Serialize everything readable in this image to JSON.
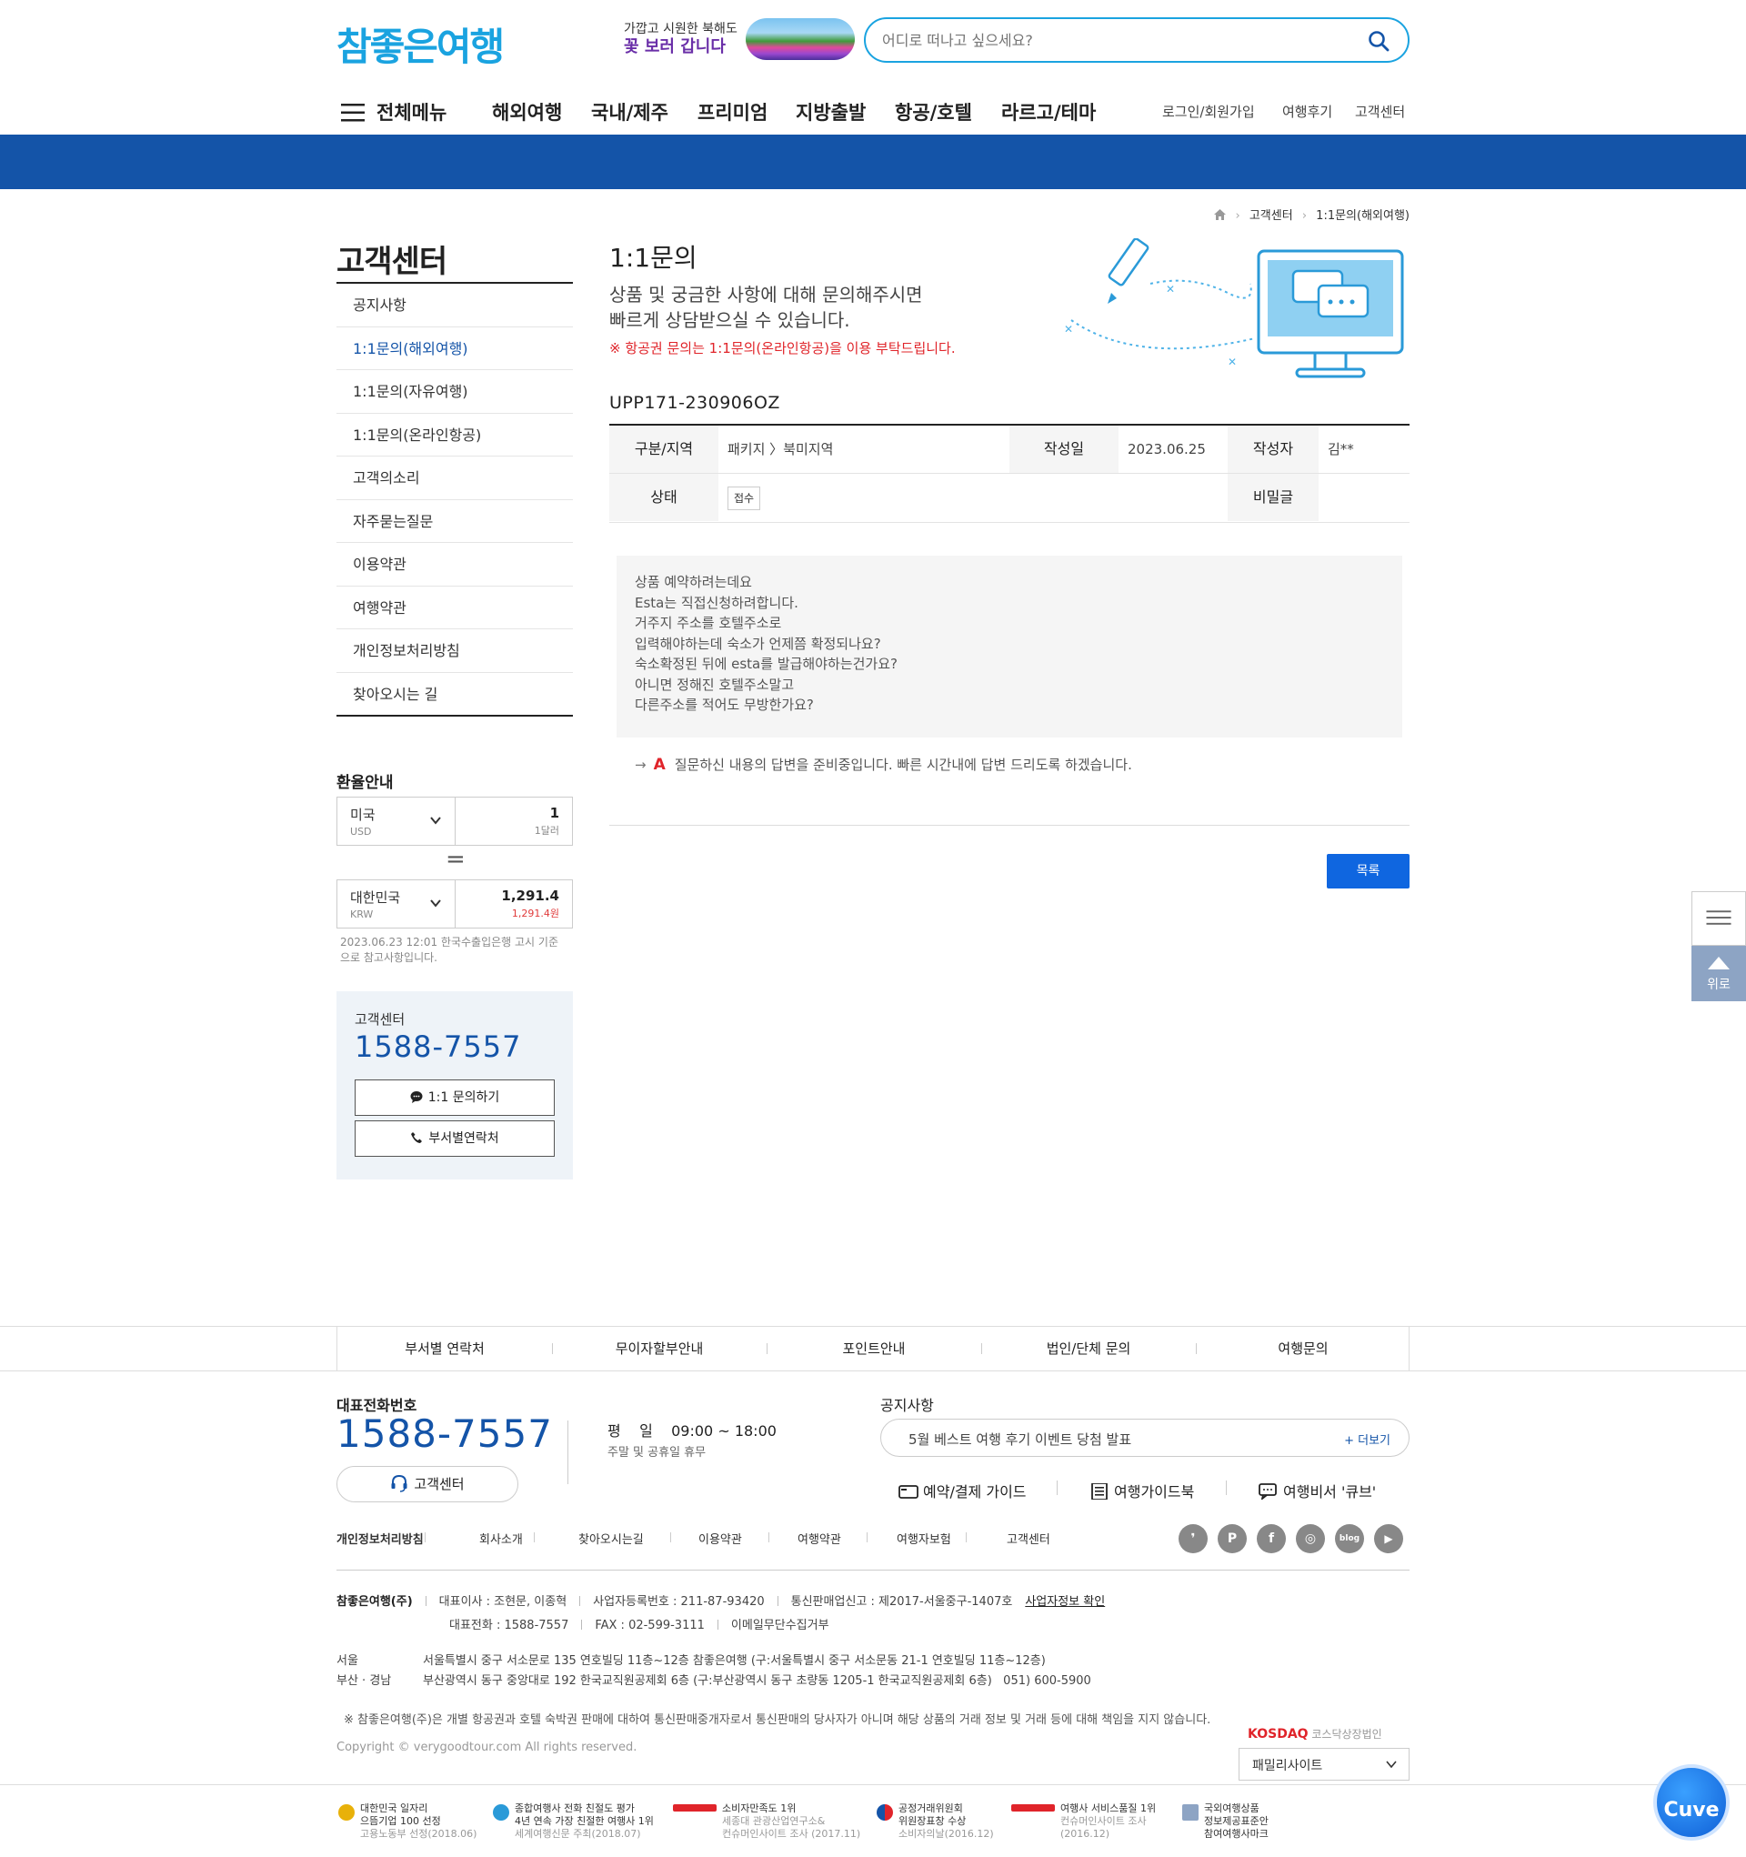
{
  "header": {
    "logo": "참좋은여행",
    "promo_line1": "가깝고 시원한 북해도",
    "promo_line2": "꽃 보러 갑니다",
    "search_placeholder": "어디로 떠나고 싶으세요?",
    "menu_label": "전체메뉴",
    "gnb": [
      "해외여행",
      "국내/제주",
      "프리미엄",
      "지방출발",
      "항공/호텔",
      "라르고/테마"
    ],
    "util": [
      "로그인/회원가입",
      "여행후기",
      "고객센터"
    ]
  },
  "breadcrumb": [
    "고객센터",
    "1:1문의(해외여행)"
  ],
  "sidebar": {
    "title": "고객센터",
    "items": [
      "공지사항",
      "1:1문의(해외여행)",
      "1:1문의(자유여행)",
      "1:1문의(온라인항공)",
      "고객의소리",
      "자주묻는질문",
      "이용약관",
      "여행약관",
      "개인정보처리방침",
      "찾아오시는 길"
    ],
    "active_index": 1
  },
  "exchange": {
    "title": "환율안내",
    "from": {
      "country": "미국",
      "code": "USD",
      "value": "1",
      "sub": "1달러"
    },
    "equals": "=",
    "to": {
      "country": "대한민국",
      "code": "KRW",
      "value": "1,291.4",
      "sub": "1,291.4원"
    },
    "note": "2023.06.23 12:01 한국수출입은행 고시 기준으로 참고사항입니다."
  },
  "cs_box": {
    "label": "고객센터",
    "phone": "1588-7557",
    "btn_inquiry": "1:1 문의하기",
    "btn_contact": "부서별연락처"
  },
  "content": {
    "title": "1:1문의",
    "desc1": "상품 및 궁금한 사항에 대해 문의해주시면",
    "desc2": "빠르게 상담받으실 수 있습니다.",
    "warn": "※ 항공권 문의는 1:1문의(온라인항공)을 이용 부탁드립니다.",
    "post_id": "UPP171-230906OZ",
    "table": {
      "category_label": "구분/지역",
      "category_value": "패키지 〉북미지역",
      "date_label": "작성일",
      "date_value": "2023.06.25",
      "author_label": "작성자",
      "author_value": "김**",
      "status_label": "상태",
      "status_value": "접수",
      "secret_label": "비밀글"
    },
    "question_lines": [
      "상품 예약하려는데요",
      "Esta는 직접신청하려합니다.",
      "거주지 주소를 호텔주소로",
      "입력해야하는데 숙소가 언제쯤 확정되나요?",
      "숙소확정된 뒤에 esta를 발급해야하는건가요?",
      "아니면 정해진 호텔주소말고",
      "다른주소를 적어도 무방한가요?"
    ],
    "answer_mark": "A",
    "answer_text": "질문하신 내용의 답변을 준비중입니다. 빠른 시간내에 답변 드리도록 하겠습니다.",
    "list_button": "목록"
  },
  "floating": {
    "top_label": "위로"
  },
  "footer": {
    "nav": [
      "부서별 연락처",
      "무이자할부안내",
      "포인트안내",
      "법인/단체 문의",
      "여행문의"
    ],
    "rep_label": "대표전화번호",
    "rep_phone": "1588-7557",
    "cs_button": "고객센터",
    "hours_line": "평    일    09:00 ~ 18:00",
    "hours_note": "주말 및 공휴일 휴무",
    "notice_label": "공지사항",
    "notice_text": "5월 베스트 여행 후기 이벤트 당첨 발표",
    "notice_more": "+ 더보기",
    "guides": [
      "예약/결제 가이드",
      "여행가이드북",
      "여행비서 '큐브'"
    ],
    "policy_links": [
      "개인정보처리방침",
      "회사소개",
      "찾아오시는길",
      "이용약관",
      "여행약관",
      "여행자보험",
      "고객센터"
    ],
    "sns": [
      "kakao-story",
      "post",
      "facebook",
      "instagram",
      "blog",
      "youtube"
    ],
    "company": "참좋은여행(주)",
    "ceo": "대표이사 : 조현문, 이종혁",
    "biz_no": "사업자등록번호 : 211-87-93420",
    "mail_order": "통신판매업신고 : 제2017-서울중구-1407호",
    "biz_link": "사업자정보 확인",
    "tel": "대표전화 : 1588-7557",
    "fax": "FAX : 02-599-3111",
    "email_refuse": "이메일무단수집거부",
    "seoul_label": "서울",
    "seoul_addr": "서울특별시 중구 서소문로 135 연호빌딩 11층~12층 참좋은여행 (구:서울특별시 중구 서소문동 21-1 연호빌딩 11층~12층)",
    "busan_label": "부산 · 경남",
    "busan_addr": "부산광역시 동구 중앙대로 192 한국교직원공제회 6층 (구:부산광역시 동구 초량동 1205-1 한국교직원공제회 6층)   051) 600-5900",
    "disclaimer": "※ 참좋은여행(주)은 개별 항공권과 호텔 숙박권 판매에 대하여 통신판매중개자로서 통신판매의 당사자가 아니며 해당 상품의 거래 정보 및 거래 등에 대해 책임을 지지 않습니다.",
    "copyright": "Copyright © verygoodtour.com All rights reserved.",
    "kosdaq": "KOSDAQ",
    "kosdaq_sub": "코스닥상장법인",
    "family_site": "패밀리사이트",
    "awards": [
      {
        "l1": "대한민국 일자리",
        "l2": "으뜸기업 100 선정",
        "l3": "고용노동부 선정(2018.06)"
      },
      {
        "l1": "종합여행사 전화 친절도 평가",
        "l2": "4년 연속 가장 친절한 여행사 1위",
        "l3": "세계여행신문 주최(2018.07)"
      },
      {
        "l1": "소비자만족도 1위",
        "l2": "세종대 관광산업연구소&",
        "l3": "컨슈머인사이트 조사 (2017.11)"
      },
      {
        "l1": "공정거래위원회",
        "l2": "위원장표창 수상",
        "l3": "소비자의날(2016.12)"
      },
      {
        "l1": "여행사 서비스품질 1위",
        "l2": "컨슈머인사이트 조사",
        "l3": "(2016.12)"
      },
      {
        "l1": "국외여행상품",
        "l2": "정보제공표준안",
        "l3": "참여여행사마크"
      }
    ],
    "chatbot": "Cuve"
  }
}
